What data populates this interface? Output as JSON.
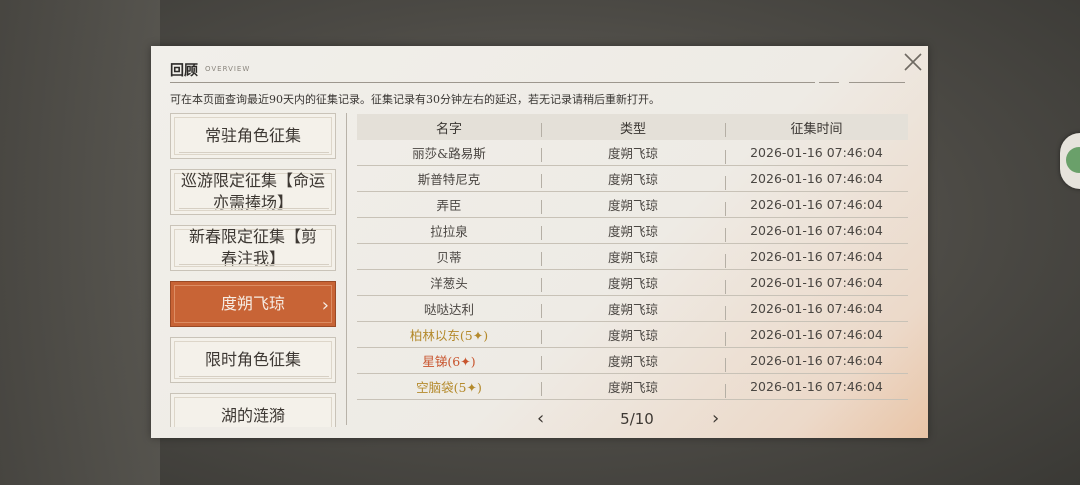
{
  "header": {
    "title": "回顾",
    "title_sub": "OVERVIEW",
    "description": "可在本页面查询最近90天内的征集记录。征集记录有30分钟左右的延迟，若无记录请稍后重新打开。"
  },
  "categories": [
    {
      "label": "常驻角色征集",
      "active": false
    },
    {
      "label": "巡游限定征集【命运亦需捧场】",
      "active": false
    },
    {
      "label": "新春限定征集【剪春注我】",
      "active": false
    },
    {
      "label": "度朔飞琼",
      "active": true
    },
    {
      "label": "限时角色征集",
      "active": false
    },
    {
      "label": "湖的涟漪",
      "active": false
    }
  ],
  "table": {
    "headers": [
      "名字",
      "类型",
      "征集时间"
    ],
    "rows": [
      {
        "name": "丽莎&路易斯",
        "type": "度朔飞琼",
        "time": "2026-01-16 07:46:04",
        "color": "#4a4642"
      },
      {
        "name": "斯普特尼克",
        "type": "度朔飞琼",
        "time": "2026-01-16 07:46:04",
        "color": "#4a4642"
      },
      {
        "name": "弄臣",
        "type": "度朔飞琼",
        "time": "2026-01-16 07:46:04",
        "color": "#4a4642"
      },
      {
        "name": "拉拉泉",
        "type": "度朔飞琼",
        "time": "2026-01-16 07:46:04",
        "color": "#4a4642"
      },
      {
        "name": "贝蒂",
        "type": "度朔飞琼",
        "time": "2026-01-16 07:46:04",
        "color": "#4a4642"
      },
      {
        "name": "洋葱头",
        "type": "度朔飞琼",
        "time": "2026-01-16 07:46:04",
        "color": "#4a4642"
      },
      {
        "name": "哒哒达利",
        "type": "度朔飞琼",
        "time": "2026-01-16 07:46:04",
        "color": "#4a4642"
      },
      {
        "name": "柏林以东(5✦)",
        "type": "度朔飞琼",
        "time": "2026-01-16 07:46:04",
        "color": "#b48a2c"
      },
      {
        "name": "星锑(6✦)",
        "type": "度朔飞琼",
        "time": "2026-01-16 07:46:04",
        "color": "#c8552e"
      },
      {
        "name": "空脑袋(5✦)",
        "type": "度朔飞琼",
        "time": "2026-01-16 07:46:04",
        "color": "#b48a2c"
      }
    ]
  },
  "pager": {
    "prev": "‹",
    "next": "›",
    "page": "5/10"
  },
  "icons": {
    "close": "close-icon",
    "chevron": "chevron-right-icon"
  }
}
